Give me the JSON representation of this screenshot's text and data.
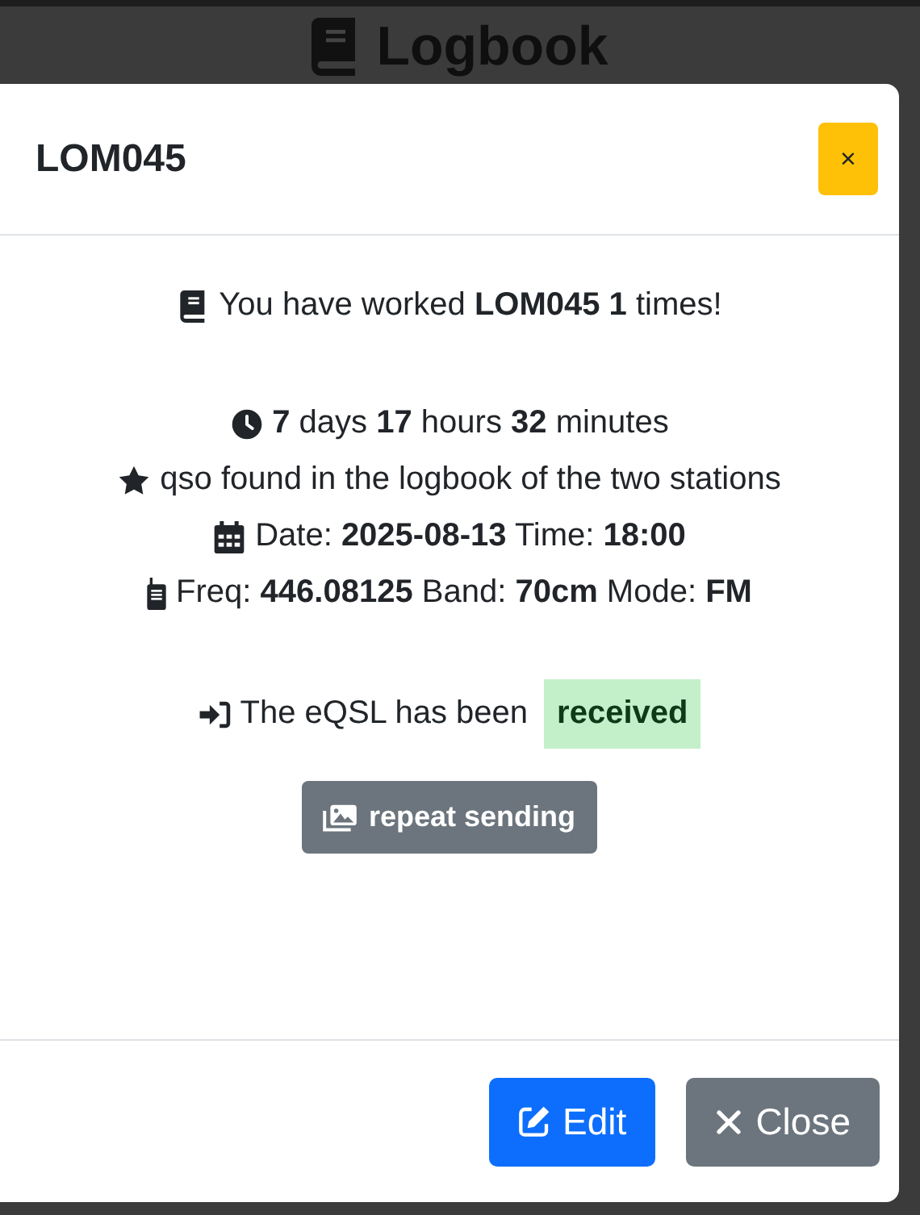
{
  "background": {
    "title": "Logbook"
  },
  "modal": {
    "title": "LOM045",
    "close_symbol": "×",
    "summary": "You have worked **LOM045 1** times!",
    "details": [
      "**7** days **17** hours **32** minutes",
      "qso found in the logbook of the two stations",
      "Date: **2025-08-13** Time: **18:00**",
      "Freq: **446.08125** Band: **70cm** Mode: **FM**"
    ],
    "eqsl": {
      "text": "The eQSL has been",
      "status": "received"
    },
    "repeat_button": "repeat sending",
    "buttons": [
      {
        "label": "Edit",
        "kind": "primary"
      },
      {
        "label": "Close",
        "kind": "secondary"
      }
    ]
  }
}
